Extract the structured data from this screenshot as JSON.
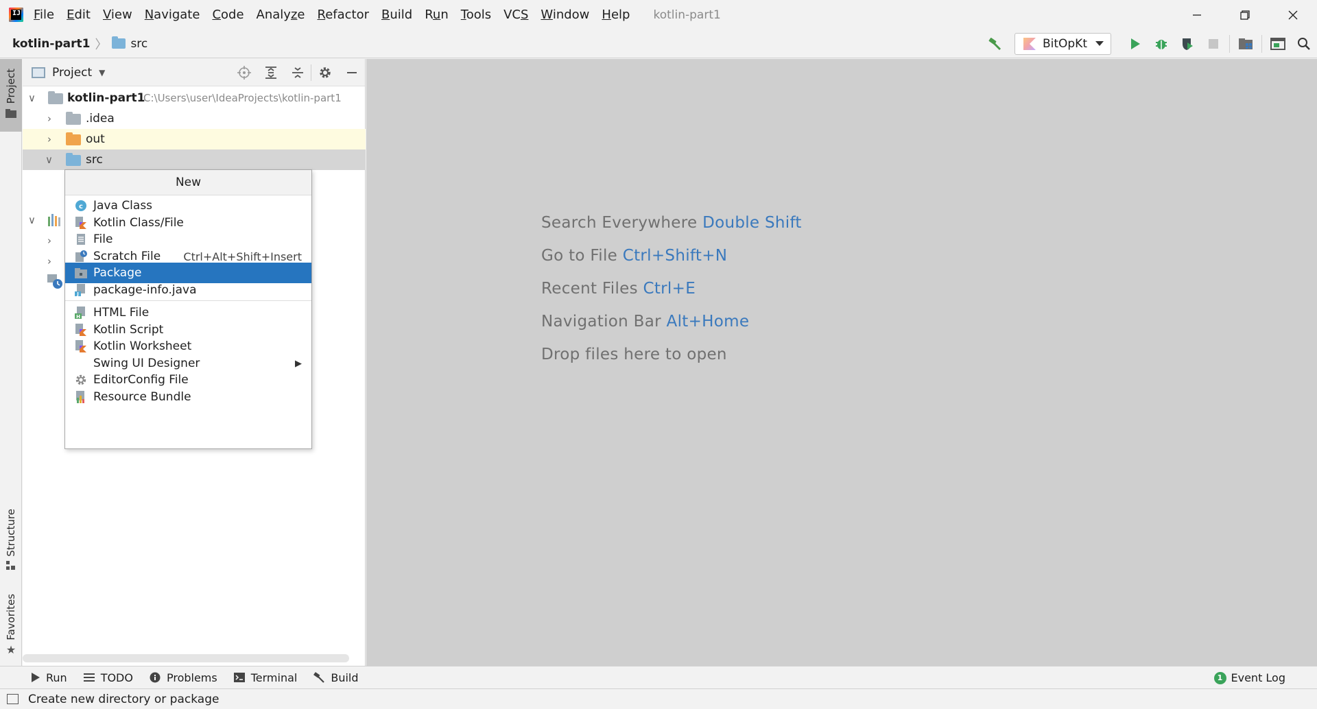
{
  "app": {
    "logo_text": "IJ",
    "window_title": "kotlin-part1"
  },
  "menu": [
    {
      "pre": "",
      "u": "F",
      "post": "ile"
    },
    {
      "pre": "",
      "u": "E",
      "post": "dit"
    },
    {
      "pre": "",
      "u": "V",
      "post": "iew"
    },
    {
      "pre": "",
      "u": "N",
      "post": "avigate"
    },
    {
      "pre": "",
      "u": "C",
      "post": "ode"
    },
    {
      "pre": "Analy",
      "u": "z",
      "post": "e"
    },
    {
      "pre": "",
      "u": "R",
      "post": "efactor"
    },
    {
      "pre": "",
      "u": "B",
      "post": "uild"
    },
    {
      "pre": "R",
      "u": "u",
      "post": "n"
    },
    {
      "pre": "",
      "u": "T",
      "post": "ools"
    },
    {
      "pre": "VC",
      "u": "S",
      "post": ""
    },
    {
      "pre": "",
      "u": "W",
      "post": "indow"
    },
    {
      "pre": "",
      "u": "H",
      "post": "elp"
    }
  ],
  "breadcrumb": {
    "project": "kotlin-part1",
    "folder": "src"
  },
  "run_config": {
    "label": "BitOpKt"
  },
  "left_strip": {
    "project": "Project",
    "structure": "Structure",
    "favorites": "Favorites"
  },
  "project_panel": {
    "title": "Project",
    "tree": {
      "root": {
        "name": "kotlin-part1",
        "path": "C:\\Users\\user\\IdeaProjects\\kotlin-part1"
      },
      "idea": ".idea",
      "out": "out",
      "src": "src"
    }
  },
  "context_menu": {
    "title": "New",
    "items": [
      {
        "label": "Java Class",
        "shortcut": "",
        "icon": "java-class-icon"
      },
      {
        "label": "Kotlin Class/File",
        "shortcut": "",
        "icon": "kotlin-file-icon"
      },
      {
        "label": "File",
        "shortcut": "",
        "icon": "file-icon"
      },
      {
        "label": "Scratch File",
        "shortcut": "Ctrl+Alt+Shift+Insert",
        "icon": "scratch-file-icon"
      },
      {
        "label": "Package",
        "shortcut": "",
        "icon": "package-icon",
        "selected": true
      },
      {
        "label": "package-info.java",
        "shortcut": "",
        "icon": "java-file-icon"
      },
      {
        "label": "HTML File",
        "shortcut": "",
        "icon": "html-file-icon"
      },
      {
        "label": "Kotlin Script",
        "shortcut": "",
        "icon": "kotlin-script-icon"
      },
      {
        "label": "Kotlin Worksheet",
        "shortcut": "",
        "icon": "kotlin-worksheet-icon"
      },
      {
        "label": "Swing UI Designer",
        "shortcut": "",
        "icon": "",
        "submenu": true
      },
      {
        "label": "EditorConfig File",
        "shortcut": "",
        "icon": "gear-icon"
      },
      {
        "label": "Resource Bundle",
        "shortcut": "",
        "icon": "resource-bundle-icon"
      }
    ]
  },
  "editor_hints": [
    {
      "text": "Search Everywhere",
      "key": "Double Shift"
    },
    {
      "text": "Go to File",
      "key": "Ctrl+Shift+N"
    },
    {
      "text": "Recent Files",
      "key": "Ctrl+E"
    },
    {
      "text": "Navigation Bar",
      "key": "Alt+Home"
    },
    {
      "text": "Drop files here to open",
      "key": ""
    }
  ],
  "bottom_tabs": {
    "run": "Run",
    "todo": "TODO",
    "problems": "Problems",
    "terminal": "Terminal",
    "build": "Build",
    "event_log": "Event Log",
    "event_count": "1"
  },
  "status": {
    "message": "Create new directory or package"
  },
  "colors": {
    "selection": "#2675bf",
    "hint_key": "#3a79bd",
    "editor_bg": "#cfcfcf",
    "run_green": "#3aa35a"
  }
}
